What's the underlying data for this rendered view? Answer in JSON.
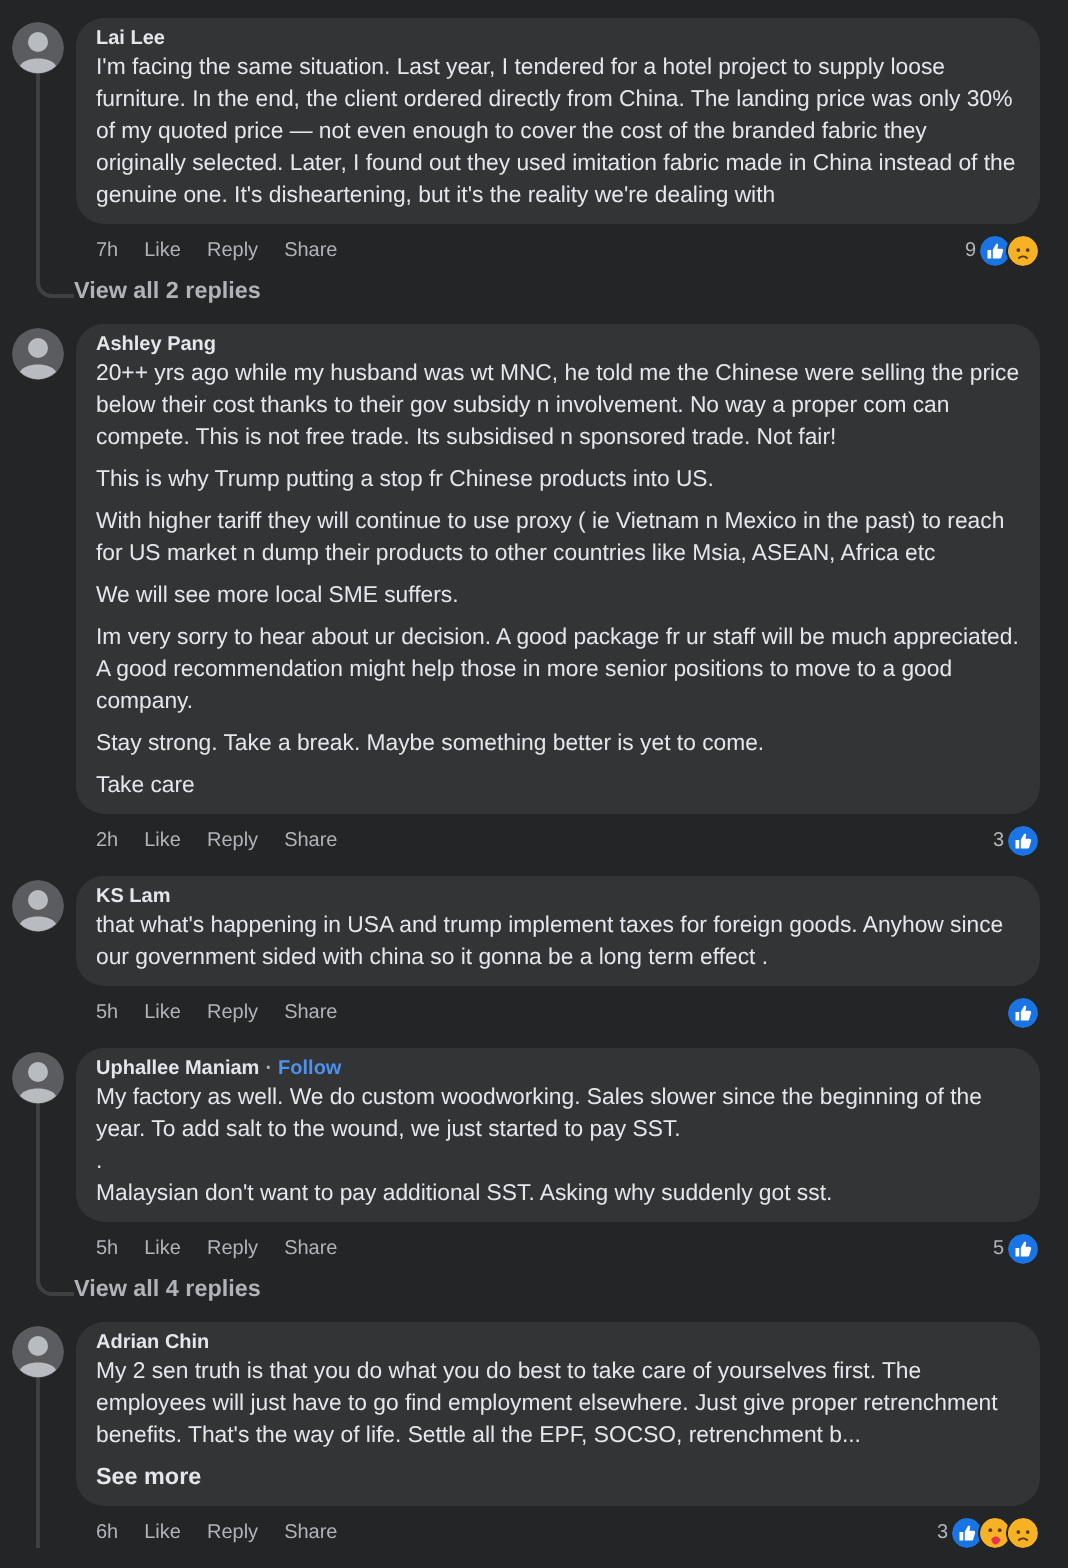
{
  "comments": [
    {
      "author": "Lai Lee",
      "paragraphs": [
        "I'm facing the same situation. Last year, I tendered for a hotel project to supply loose furniture. In the end, the client ordered directly from China. The landing price was only 30% of my quoted price — not even enough to cover the cost of the branded fabric they originally selected. Later, I found out they used imitation fabric made in China instead of the genuine one. It's disheartening, but it's the reality we're dealing with"
      ],
      "time": "7h",
      "actions": [
        "Like",
        "Reply",
        "Share"
      ],
      "reaction_count": "9",
      "reactions": [
        {
          "kind": "like"
        },
        {
          "kind": "sad"
        }
      ],
      "has_replies": true,
      "view_replies": "View all 2 replies"
    },
    {
      "author": "Ashley Pang",
      "paragraphs": [
        "20++ yrs ago while my husband was wt MNC, he told me the Chinese were selling the price below their cost thanks to their gov subsidy n involvement. No way a proper com can compete. This is not free trade. Its subsidised n sponsored trade. Not fair!",
        "This is why Trump putting a stop fr Chinese products into US.",
        "With higher tariff they will continue to use proxy ( ie Vietnam n Mexico in the past) to reach for US market n dump their products to other countries like Msia, ASEAN, Africa etc",
        "We will see more local SME suffers.",
        "Im very sorry to hear about ur decision. A good package fr ur staff will be much appreciated. A good recommendation might help those in more senior positions to move to a good company.",
        "Stay strong. Take a break. Maybe something better is yet to come.",
        "Take care"
      ],
      "time": "2h",
      "actions": [
        "Like",
        "Reply",
        "Share"
      ],
      "reaction_count": "3",
      "reactions": [
        {
          "kind": "like"
        }
      ],
      "has_replies": false
    },
    {
      "author": "KS Lam",
      "paragraphs": [
        "that what's happening in USA and trump implement taxes for foreign goods. Anyhow since our government sided with china so it gonna be a long term effect ."
      ],
      "time": "5h",
      "actions": [
        "Like",
        "Reply",
        "Share"
      ],
      "reactions": [
        {
          "kind": "like"
        }
      ],
      "has_replies": false
    },
    {
      "author": "Uphallee Maniam",
      "separator": "·",
      "follow": "Follow",
      "paragraphs": [
        "My factory as well. We do custom woodworking. Sales slower since the beginning of the year. To add salt to the wound, we just started to pay SST.\n.\nMalaysian don't want to pay additional SST. Asking why suddenly got sst."
      ],
      "time": "5h",
      "actions": [
        "Like",
        "Reply",
        "Share"
      ],
      "reaction_count": "5",
      "reactions": [
        {
          "kind": "like"
        }
      ],
      "has_replies": true,
      "view_replies": "View all 4 replies"
    },
    {
      "author": "Adrian Chin",
      "paragraphs": [
        "My 2 sen truth is that you do what you do best to take care of yourselves first. The employees will just have to go find employment elsewhere. Just give proper retrenchment benefits. That's the way of life. Settle all the EPF, SOCSO, retrenchment b..."
      ],
      "see_more": "See more",
      "time": "6h",
      "actions": [
        "Like",
        "Reply",
        "Share"
      ],
      "reaction_count": "3",
      "reactions": [
        {
          "kind": "like"
        },
        {
          "kind": "care"
        },
        {
          "kind": "sad"
        }
      ],
      "has_replies": true
    }
  ]
}
